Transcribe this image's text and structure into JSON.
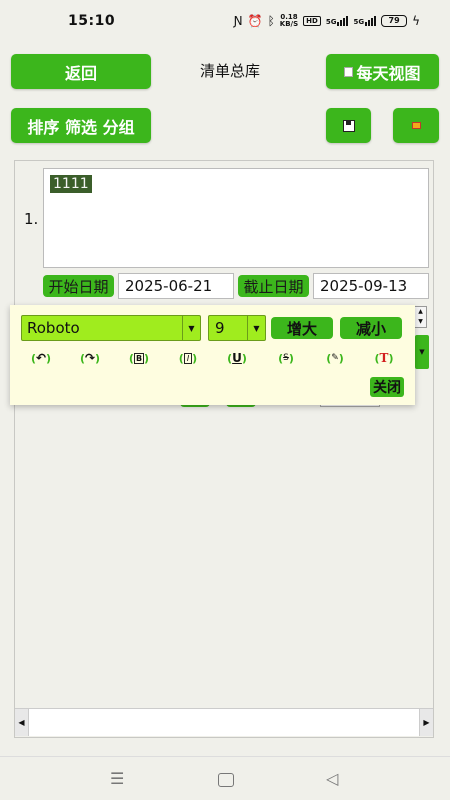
{
  "status_bar": {
    "time": "15:10",
    "netspeed_value": "0.18",
    "netspeed_unit": "KB/S",
    "hd": "HD",
    "signal1": "5G",
    "signal2": "5G",
    "battery": "79",
    "icons": [
      "nfc-icon",
      "alarm-icon",
      "bluetooth-icon",
      "charging-icon"
    ]
  },
  "header": {
    "back_label": "返回",
    "title": "清单总库",
    "daily_view_label": "每天视图"
  },
  "toolbar": {
    "sort_filter_group_label": "排序 筛选 分组",
    "save_icon": "save-icon",
    "extra_icon": "color-icon"
  },
  "item": {
    "number": "1.",
    "text": "1111"
  },
  "dates": {
    "start_label": "开始日期",
    "start_value": "2025-06-21",
    "end_label": "截止日期",
    "end_value": "2025-09-13"
  },
  "format_popup": {
    "font_name": "Roboto",
    "font_size": "9",
    "increase_label": "增大",
    "decrease_label": "减小",
    "close_label": "关闭",
    "tools": [
      {
        "name": "undo-icon",
        "glyph": "↶"
      },
      {
        "name": "redo-icon",
        "glyph": "↷"
      },
      {
        "name": "bold-icon",
        "glyph": "B"
      },
      {
        "name": "italic-icon",
        "glyph": "I"
      },
      {
        "name": "underline-icon",
        "glyph": "U"
      },
      {
        "name": "strikethrough-icon",
        "glyph": "S"
      },
      {
        "name": "clear-format-icon",
        "glyph": "✎"
      },
      {
        "name": "text-color-icon",
        "glyph": "T"
      }
    ]
  },
  "colors": {
    "accent": "#3cb61c",
    "selector_fill": "#a0ec1e",
    "popup_bg": "#fefde0",
    "selection": "#3b5e2a"
  }
}
